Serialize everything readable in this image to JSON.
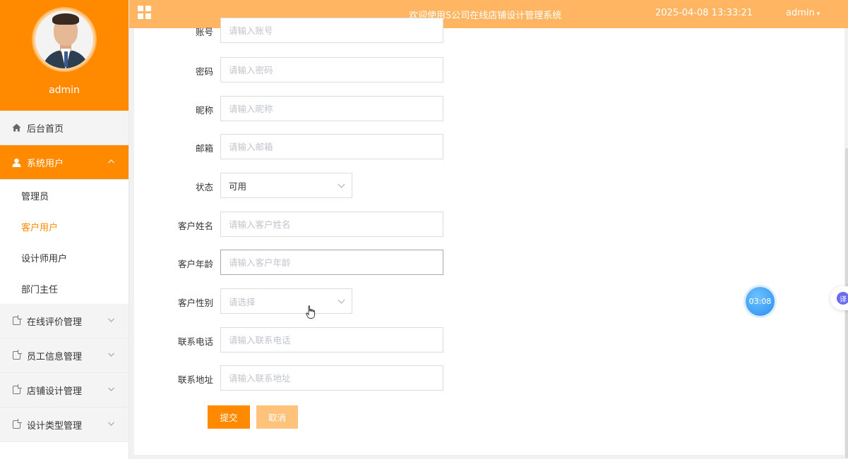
{
  "header": {
    "title": "欢迎使用S公司在线店铺设计管理系统",
    "datetime": "2025-04-08 13:33:21",
    "user": "admin",
    "menu_icon": "grid-icon",
    "colors": {
      "header_bg": "#ffb561",
      "accent": "#ff8a00"
    }
  },
  "sidebar": {
    "profile_name": "admin",
    "items": [
      {
        "label": "后台首页",
        "icon": "home-icon"
      },
      {
        "label": "系统用户",
        "icon": "user-icon",
        "active": true,
        "expanded": true
      },
      {
        "label": "在线评价管理",
        "icon": "document-icon"
      },
      {
        "label": "员工信息管理",
        "icon": "document-icon"
      },
      {
        "label": "店铺设计管理",
        "icon": "document-icon"
      },
      {
        "label": "设计类型管理",
        "icon": "document-icon"
      }
    ],
    "submenu": [
      {
        "label": "管理员"
      },
      {
        "label": "客户用户",
        "active": true
      },
      {
        "label": "设计师用户"
      },
      {
        "label": "部门主任"
      }
    ]
  },
  "form": {
    "account": {
      "label": "账号",
      "placeholder": "请输入账号"
    },
    "password": {
      "label": "密码",
      "placeholder": "请输入密码"
    },
    "nickname": {
      "label": "昵称",
      "placeholder": "请输入昵称"
    },
    "email": {
      "label": "邮箱",
      "placeholder": "请输入邮箱"
    },
    "status": {
      "label": "状态",
      "value": "可用"
    },
    "customer_name": {
      "label": "客户姓名",
      "placeholder": "请输入客户姓名"
    },
    "customer_age": {
      "label": "客户年龄",
      "placeholder": "请输入客户年龄"
    },
    "customer_gender": {
      "label": "客户性别",
      "placeholder": "请选择"
    },
    "phone": {
      "label": "联系电话",
      "placeholder": "请输入联系电话"
    },
    "address": {
      "label": "联系地址",
      "placeholder": "请输入联系地址"
    },
    "submit_label": "提交",
    "cancel_label": "取消"
  },
  "overlay": {
    "timer": "03:08",
    "translate_glyph": "译"
  }
}
